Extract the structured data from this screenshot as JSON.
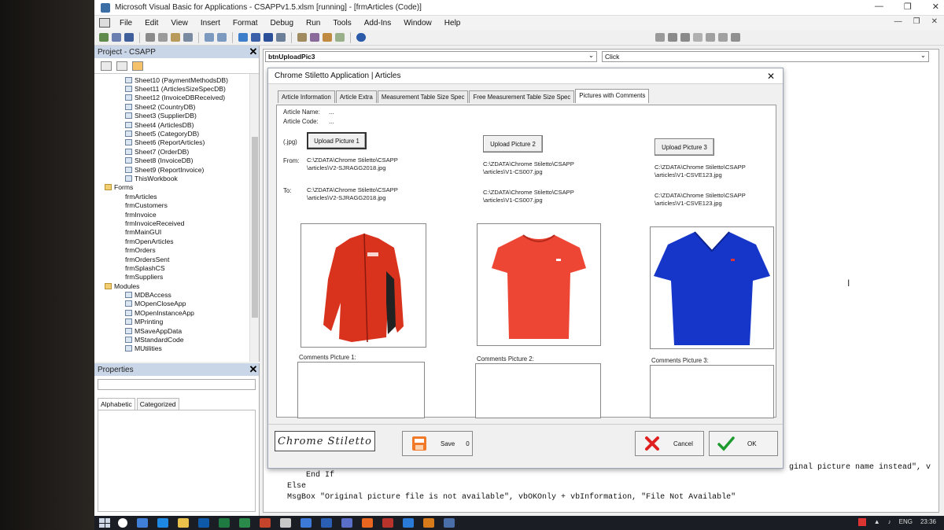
{
  "window": {
    "title": "Microsoft Visual Basic for Applications - CSAPPv1.5.xlsm [running] - [frmArticles (Code)]"
  },
  "menu": [
    "File",
    "Edit",
    "View",
    "Insert",
    "Format",
    "Debug",
    "Run",
    "Tools",
    "Add-Ins",
    "Window",
    "Help"
  ],
  "project": {
    "title": "Project - CSAPP",
    "items": [
      {
        "kind": "sheet",
        "label": "Sheet10 (PaymentMethodsDB)",
        "indent": 3
      },
      {
        "kind": "sheet",
        "label": "Sheet11 (ArticlesSizeSpecDB)",
        "indent": 3
      },
      {
        "kind": "sheet",
        "label": "Sheet12 (InvoiceDBReceived)",
        "indent": 3
      },
      {
        "kind": "sheet",
        "label": "Sheet2 (CountryDB)",
        "indent": 3
      },
      {
        "kind": "sheet",
        "label": "Sheet3 (SupplierDB)",
        "indent": 3
      },
      {
        "kind": "sheet",
        "label": "Sheet4 (ArticlesDB)",
        "indent": 3
      },
      {
        "kind": "sheet",
        "label": "Sheet5 (CategoryDB)",
        "indent": 3
      },
      {
        "kind": "sheet",
        "label": "Sheet6 (ReportArticles)",
        "indent": 3
      },
      {
        "kind": "sheet",
        "label": "Sheet7 (OrderDB)",
        "indent": 3
      },
      {
        "kind": "sheet",
        "label": "Sheet8 (InvoiceDB)",
        "indent": 3
      },
      {
        "kind": "sheet",
        "label": "Sheet9 (ReportInvoice)",
        "indent": 3
      },
      {
        "kind": "sheet",
        "label": "ThisWorkbook",
        "indent": 3
      },
      {
        "kind": "folder",
        "label": "Forms",
        "indent": 1
      },
      {
        "kind": "form",
        "label": "frmArticles",
        "indent": 3
      },
      {
        "kind": "form",
        "label": "frmCustomers",
        "indent": 3
      },
      {
        "kind": "form",
        "label": "frmInvoice",
        "indent": 3
      },
      {
        "kind": "form",
        "label": "frmInvoiceReceived",
        "indent": 3
      },
      {
        "kind": "form",
        "label": "frmMainGUI",
        "indent": 3
      },
      {
        "kind": "form",
        "label": "frmOpenArticles",
        "indent": 3
      },
      {
        "kind": "form",
        "label": "frmOrders",
        "indent": 3
      },
      {
        "kind": "form",
        "label": "frmOrdersSent",
        "indent": 3
      },
      {
        "kind": "form",
        "label": "frmSplashCS",
        "indent": 3
      },
      {
        "kind": "form",
        "label": "frmSuppliers",
        "indent": 3
      },
      {
        "kind": "folder",
        "label": "Modules",
        "indent": 1
      },
      {
        "kind": "module",
        "label": "MDBAccess",
        "indent": 3
      },
      {
        "kind": "module",
        "label": "MOpenCloseApp",
        "indent": 3
      },
      {
        "kind": "module",
        "label": "MOpenInstanceApp",
        "indent": 3
      },
      {
        "kind": "module",
        "label": "MPrinting",
        "indent": 3
      },
      {
        "kind": "module",
        "label": "MSaveAppData",
        "indent": 3
      },
      {
        "kind": "module",
        "label": "MStandardCode",
        "indent": 3
      },
      {
        "kind": "module",
        "label": "MUtilities",
        "indent": 3
      }
    ]
  },
  "properties": {
    "title": "Properties",
    "tabs": [
      "Alphabetic",
      "Categorized"
    ]
  },
  "code": {
    "object": "btnUploadPic3",
    "procedure": "Click",
    "lines": [
      "        End If",
      "    Else",
      "    MsgBox \"Original picture file is not available\", vbOKOnly + vbInformation, \"File Not Available\""
    ],
    "fragment": "ginal picture name instead\", v"
  },
  "form": {
    "title": "Chrome Stiletto Application | Articles",
    "tabs": [
      "Article Information",
      "Article Extra",
      "Measurement Table Size Spec",
      "Free Measurement Table Size Spec",
      "Pictures with Comments"
    ],
    "active_tab": 4,
    "article_name_label": "Article Name:",
    "article_name_value": "...",
    "article_code_label": "Article Code:",
    "article_code_value": "...",
    "ext_label": "(.jpg)",
    "from_label": "From:",
    "to_label": "To:",
    "pictures": [
      {
        "button": "Upload Picture 1",
        "from": "C:\\ZDATA\\Chrome Stiletto\\CSAPP\n\\articles\\V2-SJRAGG2018.jpg",
        "to": "C:\\ZDATA\\Chrome Stiletto\\CSAPP\n\\articles\\V2-SJRAGG2018.jpg",
        "comments_label": "Comments Picture 1:",
        "garment": "jacket",
        "color": "#d9321d"
      },
      {
        "button": "Upload Picture 2",
        "from": "C:\\ZDATA\\Chrome Stiletto\\CSAPP\n\\articles\\V1-CS007.jpg",
        "to": "C:\\ZDATA\\Chrome Stiletto\\CSAPP\n\\articles\\V1-CS007.jpg",
        "comments_label": "Comments Picture 2:",
        "garment": "tshirt",
        "color": "#ee4635"
      },
      {
        "button": "Upload Picture 3",
        "from": "C:\\ZDATA\\Chrome Stiletto\\CSAPP\n\\articles\\V1-CSVE123.jpg",
        "to": "C:\\ZDATA\\Chrome Stiletto\\CSAPP\n\\articles\\V1-CSVE123.jpg",
        "comments_label": "Comments Picture 3:",
        "garment": "vneck",
        "color": "#1636c9"
      }
    ],
    "footer": {
      "logo": "Chrome Stiletto",
      "save": "Save",
      "save_count": "0",
      "cancel": "Cancel",
      "ok": "OK"
    }
  },
  "taskbar": {
    "lang": "ENG",
    "time": "23:36"
  }
}
